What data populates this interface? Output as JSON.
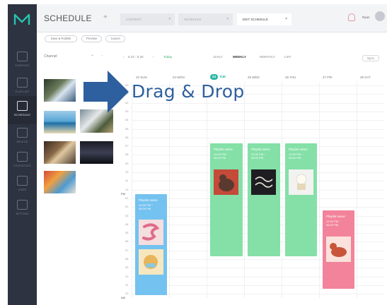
{
  "app": {
    "title": "SCHEDULE",
    "tabs": [
      {
        "label": "CONTENT",
        "state": "dim"
      },
      {
        "label": "SCHEDULE",
        "state": "dim"
      },
      {
        "label": "EDIT SCHEDULE",
        "state": "active"
      }
    ],
    "user_name": "Ryan",
    "colors": {
      "accent": "#2ab7a4",
      "rail": "#2d3340",
      "event_blue": "#74c2ef",
      "event_green": "#84e0a7",
      "event_pink": "#f2839a"
    }
  },
  "sidebar": {
    "items": [
      {
        "label": "CONTENT",
        "icon": "content-icon"
      },
      {
        "label": "PLAYLIST",
        "icon": "playlist-icon"
      },
      {
        "label": "SCHEDULE",
        "icon": "calendar-icon",
        "active": true
      },
      {
        "label": "DEVICE",
        "icon": "monitor-icon"
      },
      {
        "label": "STATISTICS",
        "icon": "statistics-icon"
      },
      {
        "label": "USER",
        "icon": "user-icon"
      },
      {
        "label": "SETTING",
        "icon": "setting-icon"
      }
    ]
  },
  "actions": {
    "save_publish": "Save & Publish",
    "preview": "Preview",
    "cancel": "Cancel"
  },
  "channel": {
    "title": "Channel",
    "add": "+",
    "remove": "−"
  },
  "toolbar": {
    "date_range": "6.23 - 6.29",
    "today": "Today",
    "views": {
      "daily": "DAILY",
      "weekly": "WEEKLY",
      "monthly": "MONTHLY",
      "list": "LIST"
    },
    "sync": "Sync"
  },
  "week": {
    "days": [
      {
        "num": "23",
        "day": "SUN"
      },
      {
        "num": "24",
        "day": "MON"
      },
      {
        "num": "24",
        "day": "TUE",
        "today": true
      },
      {
        "num": "25",
        "day": "WED"
      },
      {
        "num": "26",
        "day": "THU"
      },
      {
        "num": "27",
        "day": "FRI"
      },
      {
        "num": "28",
        "day": "SAT"
      }
    ]
  },
  "hours": [
    "00",
    "01",
    "02",
    "03",
    "04",
    "05",
    "06",
    "07",
    "08",
    "09",
    "10",
    "11",
    "12",
    "01",
    "02",
    "03",
    "04",
    "05",
    "06",
    "07",
    "08",
    "09",
    "10",
    "11",
    "12"
  ],
  "ampm": {
    "pm": "PM",
    "am": "AM"
  },
  "events": [
    {
      "name": "Playlist name",
      "time": "12:00 PM ~ 06:00 PM",
      "color": "blue"
    },
    {
      "name": "Playlist name",
      "time": "12:00 PM ~ 06:00 PM",
      "color": "green"
    },
    {
      "name": "Playlist name",
      "time": "12:00 PM ~ 06:00 PM",
      "color": "green"
    },
    {
      "name": "Playlist name",
      "time": "12:00 PM ~ 06:00 PM",
      "color": "green"
    },
    {
      "name": "Playlist name",
      "time": "12:00 PM ~ 06:00 PM",
      "color": "pink"
    }
  ],
  "overlay": {
    "drag_drop": "Drag & Drop"
  }
}
